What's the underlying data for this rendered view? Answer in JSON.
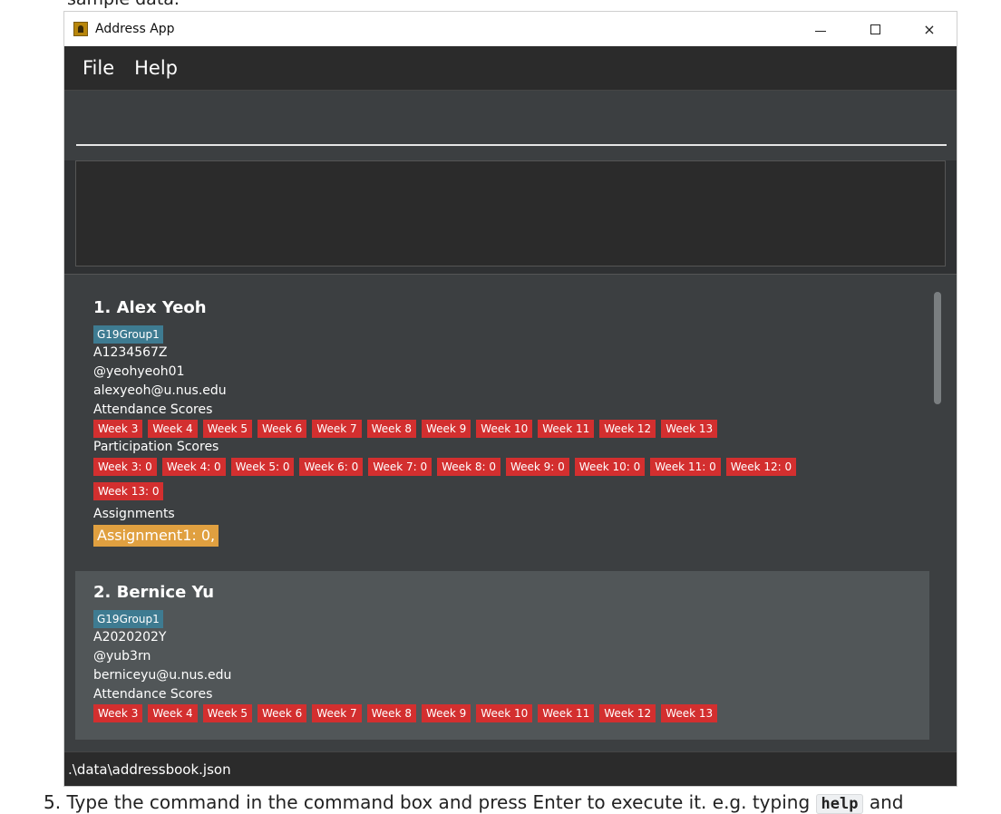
{
  "doc": {
    "top_text": "sample data.",
    "bottom_prefix": "5. Type the command in the command box and press Enter to execute it. e.g. typing",
    "bottom_code": "help",
    "bottom_suffix": "and"
  },
  "window": {
    "title": "Address App",
    "icon": "address-book-icon"
  },
  "controls": {
    "minimize": "minimize-icon",
    "maximize": "maximize-icon",
    "close": "×"
  },
  "menu": {
    "items": [
      "File",
      "Help"
    ]
  },
  "command_box": {
    "value": "",
    "placeholder": ""
  },
  "result_box": {
    "text": ""
  },
  "persons": [
    {
      "index_name": "1.  Alex Yeoh",
      "group": "G19Group1",
      "student_id": "A1234567Z",
      "telegram": "@yeohyeoh01",
      "email": "alexyeoh@u.nus.edu",
      "attendance_label": "Attendance Scores",
      "attendance": [
        "Week 3",
        "Week 4",
        "Week 5",
        "Week 6",
        "Week 7",
        "Week 8",
        "Week 9",
        "Week 10",
        "Week 11",
        "Week 12",
        "Week 13"
      ],
      "participation_label": "Participation Scores",
      "participation_row1": [
        "Week 3: 0",
        "Week 4: 0",
        "Week 5: 0",
        "Week 6: 0",
        "Week 7: 0",
        "Week 8: 0",
        "Week 9: 0",
        "Week 10: 0",
        "Week 11: 0",
        "Week 12: 0"
      ],
      "participation_row2": [
        "Week 13: 0"
      ],
      "assignments_label": "Assignments",
      "assignments": "Assignment1: 0,"
    },
    {
      "index_name": "2.  Bernice Yu",
      "group": "G19Group1",
      "student_id": "A2020202Y",
      "telegram": "@yub3rn",
      "email": "berniceyu@u.nus.edu",
      "attendance_label": "Attendance Scores",
      "attendance": [
        "Week 3",
        "Week 4",
        "Week 5",
        "Week 6",
        "Week 7",
        "Week 8",
        "Week 9",
        "Week 10",
        "Week 11",
        "Week 12",
        "Week 13"
      ]
    }
  ],
  "status": {
    "path": ".\\data\\addressbook.json"
  }
}
